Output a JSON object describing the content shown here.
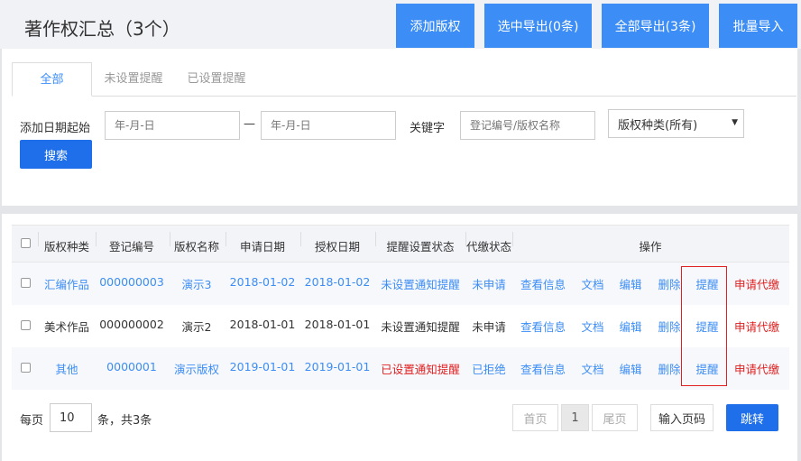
{
  "header": {
    "title": "著作权汇总（3个）",
    "buttons": {
      "add": "添加版权",
      "export_selected": "选中导出(0条)",
      "export_all": "全部导出(3条)",
      "batch_import": "批量导入"
    }
  },
  "tabs": [
    {
      "label": "全部",
      "active": true
    },
    {
      "label": "未设置提醒",
      "active": false
    },
    {
      "label": "已设置提醒",
      "active": false
    }
  ],
  "filters": {
    "date_label": "添加日期起始",
    "date_sep": "—",
    "date_start_placeholder": "年-月-日",
    "date_end_placeholder": "年-月-日",
    "keyword_label": "关键字",
    "keyword_placeholder": "登记编号/版权名称",
    "type_select": "版权种类(所有)",
    "search_button": "搜索"
  },
  "table": {
    "headers": [
      "版权种类",
      "登记编号",
      "版权名称",
      "申请日期",
      "授权日期",
      "提醒设置状态",
      "代缴状态",
      "操作"
    ],
    "rows": [
      {
        "type": "汇编作品",
        "reg_no": "000000003",
        "name": "演示3",
        "apply_date": "2018-01-02",
        "grant_date": "2018-01-02",
        "remind_status": "未设置通知提醒",
        "pay_status": "未申请",
        "view": "查看信息",
        "doc": "文档",
        "edit": "编辑",
        "delete": "删除",
        "remind": "提醒",
        "apply_pay": "申请代缴"
      },
      {
        "type": "美术作品",
        "reg_no": "000000002",
        "name": "演示2",
        "apply_date": "2018-01-01",
        "grant_date": "2018-01-01",
        "remind_status": "未设置通知提醒",
        "pay_status": "未申请",
        "view": "查看信息",
        "doc": "文档",
        "edit": "编辑",
        "delete": "删除",
        "remind": "提醒",
        "apply_pay": "申请代缴"
      },
      {
        "type": "其他",
        "reg_no": "0000001",
        "name": "演示版权",
        "apply_date": "2019-01-01",
        "grant_date": "2019-01-01",
        "remind_status": "已设置通知提醒",
        "pay_status": "已拒绝",
        "view": "查看信息",
        "doc": "文档",
        "edit": "编辑",
        "delete": "删除",
        "remind": "提醒",
        "apply_pay": "申请代缴"
      }
    ]
  },
  "pagination": {
    "per_page_label": "每页",
    "per_page_value": "10",
    "total_label": "条，共3条",
    "first": "首页",
    "current": "1",
    "last": "尾页",
    "page_input_placeholder": "输入页码",
    "jump": "跳转"
  },
  "colors": {
    "accent": "#3c8df5",
    "button_blue": "#1e6fe9",
    "danger": "#e02020"
  }
}
